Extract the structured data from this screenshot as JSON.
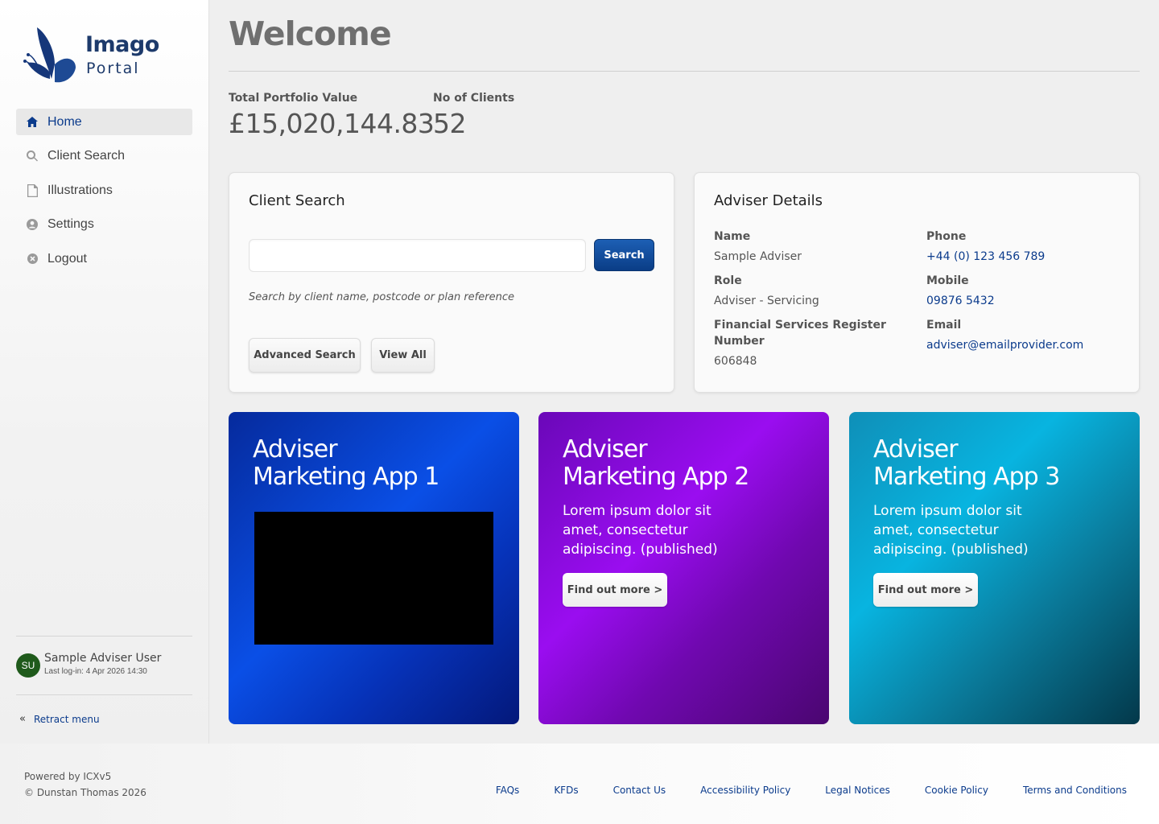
{
  "logo": {
    "line1": "Imago",
    "line2": "Portal"
  },
  "nav": [
    {
      "label": "Home",
      "icon": "home-icon",
      "active": true
    },
    {
      "label": "Client Search",
      "icon": "search-icon"
    },
    {
      "label": "Illustrations",
      "icon": "document-icon"
    },
    {
      "label": "Settings",
      "icon": "user-circle-icon"
    },
    {
      "label": "Logout",
      "icon": "close-circle-icon"
    }
  ],
  "user": {
    "initials": "SU",
    "name": "Sample Adviser User",
    "last_login": "Last log-in: 4 Apr 2026 14:30",
    "avatar_color": "#1f5a1b"
  },
  "retract_label": "Retract menu",
  "page": {
    "title": "Welcome"
  },
  "stats": {
    "portfolio_label": "Total Portfolio Value",
    "portfolio_value": "£15,020,144.83",
    "clients_label": "No of Clients",
    "clients_value": "52"
  },
  "client_search": {
    "title": "Client Search",
    "search_value": "",
    "search_button": "Search",
    "hint": "Search by client name, postcode or plan reference",
    "advanced_button": "Advanced Search",
    "view_all_button": "View All"
  },
  "adviser": {
    "title": "Adviser Details",
    "name_label": "Name",
    "name_value": "Sample Adviser",
    "role_label": "Role",
    "role_value": "Adviser - Servicing",
    "fsr_label_1": "Financial Services Register",
    "fsr_label_2": "Number",
    "fsr_value": "606848",
    "phone_label": "Phone",
    "phone_value": "+44 (0) 123 456 789",
    "mobile_label": "Mobile",
    "mobile_value": "09876 5432",
    "email_label": "Email",
    "email_value": "adviser@emailprovider.com"
  },
  "promos": [
    {
      "line1": "Adviser",
      "line2": "Marketing App 1"
    },
    {
      "line1": "Adviser",
      "line2": "Marketing App 2",
      "text": "Lorem ipsum dolor sit amet, consectetur adipiscing. (published)",
      "button": "Find out more >"
    },
    {
      "line1": "Adviser",
      "line2": "Marketing App 3",
      "text": "Lorem ipsum dolor sit amet, consectetur adipiscing. (published)",
      "button": "Find out more >"
    }
  ],
  "footer": {
    "powered": "Powered by ICXv5",
    "copyright": "© Dunstan Thomas 2026",
    "links": [
      "FAQs",
      "KFDs",
      "Contact Us",
      "Accessibility Policy",
      "Legal Notices",
      "Cookie Policy",
      "Terms and Conditions"
    ]
  },
  "colors": {
    "accent": "#0b3b8c",
    "promo1": "#0a4fe6",
    "promo2": "#9a0df0",
    "promo3": "#08c4f2"
  }
}
